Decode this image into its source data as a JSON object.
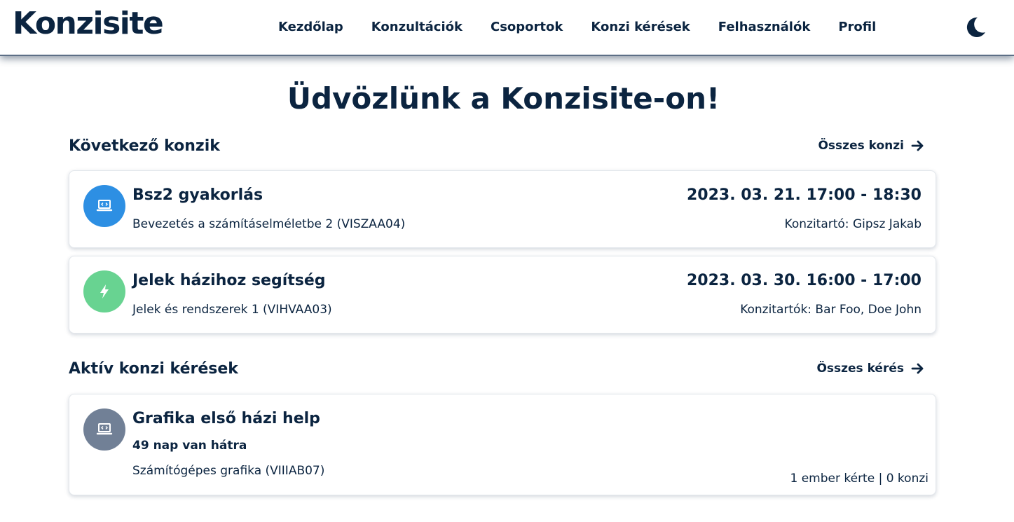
{
  "app": {
    "logo": "Konzisite"
  },
  "nav": {
    "items": [
      {
        "label": "Kezdőlap"
      },
      {
        "label": "Konzultációk"
      },
      {
        "label": "Csoportok"
      },
      {
        "label": "Konzi kérések"
      },
      {
        "label": "Felhasználók"
      },
      {
        "label": "Profil"
      }
    ],
    "theme_icon": "moon-icon"
  },
  "page": {
    "title": "Üdvözlünk a Konzisite-on!"
  },
  "upcoming": {
    "title": "Következő konzik",
    "link_label": "Összes konzi",
    "link_icon": "arrow-right-icon",
    "items": [
      {
        "title": "Bsz2 gyakorlás",
        "subject": "Bevezetés a számításelméletbe 2 (VISZAA04)",
        "time": "2023. 03. 21. 17:00 - 18:30",
        "presenters": "Konzitartó: Gipsz Jakab",
        "icon": "laptop-code-icon",
        "color": "#2d8fe3"
      },
      {
        "title": "Jelek házihoz segítség",
        "subject": "Jelek és rendszerek 1 (VIHVAA03)",
        "time": "2023. 03. 30. 16:00 - 17:00",
        "presenters": "Konzitartók: Bar Foo, Doe John",
        "icon": "lightning-icon",
        "color": "#68d391"
      }
    ]
  },
  "requests": {
    "title": "Aktív konzi kérések",
    "link_label": "Összes kérés",
    "link_icon": "arrow-right-icon",
    "items": [
      {
        "title": "Grafika első házi help",
        "remaining": "49 nap van hátra",
        "subject": "Számítógépes grafika (VIIIAB07)",
        "stats": "1 ember kérte | 0 konzi",
        "icon": "laptop-code-icon",
        "color": "#718096"
      }
    ]
  },
  "colors": {
    "primary": "#0b2440",
    "border": "#e3e7ec"
  }
}
